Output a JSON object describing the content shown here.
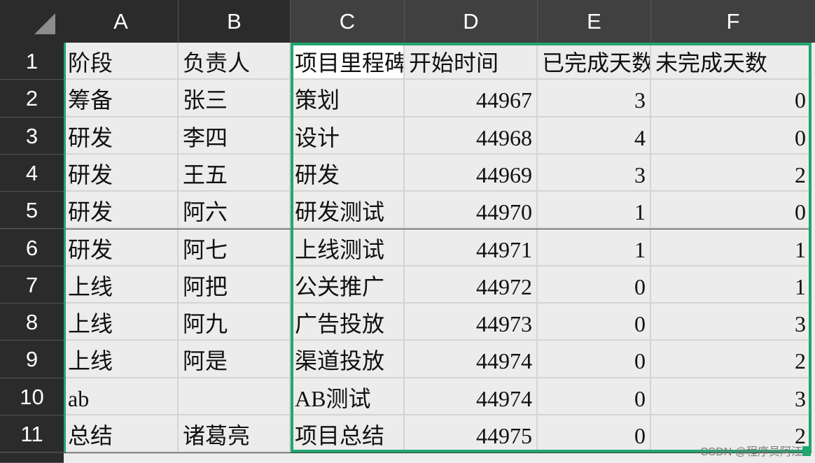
{
  "columns": [
    "A",
    "B",
    "C",
    "D",
    "E",
    "F"
  ],
  "rows_numbers": [
    "1",
    "2",
    "3",
    "4",
    "5",
    "6",
    "7",
    "8",
    "9",
    "10",
    "11"
  ],
  "table": {
    "header": [
      "阶段",
      "负责人",
      "项目里程碑",
      "开始时间",
      "已完成天数",
      "未完成天数"
    ],
    "rows": [
      [
        "筹备",
        "张三",
        "策划",
        "44967",
        "3",
        "0"
      ],
      [
        "研发",
        "李四",
        "设计",
        "44968",
        "4",
        "0"
      ],
      [
        "研发",
        "王五",
        "研发",
        "44969",
        "3",
        "2"
      ],
      [
        "研发",
        "阿六",
        "研发测试",
        "44970",
        "1",
        "0"
      ],
      [
        "研发",
        "阿七",
        "上线测试",
        "44971",
        "1",
        "1"
      ],
      [
        "上线",
        "阿把",
        "公关推广",
        "44972",
        "0",
        "1"
      ],
      [
        "上线",
        "阿九",
        "广告投放",
        "44973",
        "0",
        "3"
      ],
      [
        "上线",
        "阿是",
        "渠道投放",
        "44974",
        "0",
        "2"
      ],
      [
        "ab",
        "",
        "AB测试",
        "44974",
        "0",
        "3"
      ],
      [
        "总结",
        "诸葛亮",
        "项目总结",
        "44975",
        "0",
        "2"
      ]
    ]
  },
  "watermark": "CSDN @程序员阿江",
  "colors": {
    "selection": "#21a66f",
    "header_bg": "#2b2b2b",
    "cell_bg": "#ececec"
  }
}
